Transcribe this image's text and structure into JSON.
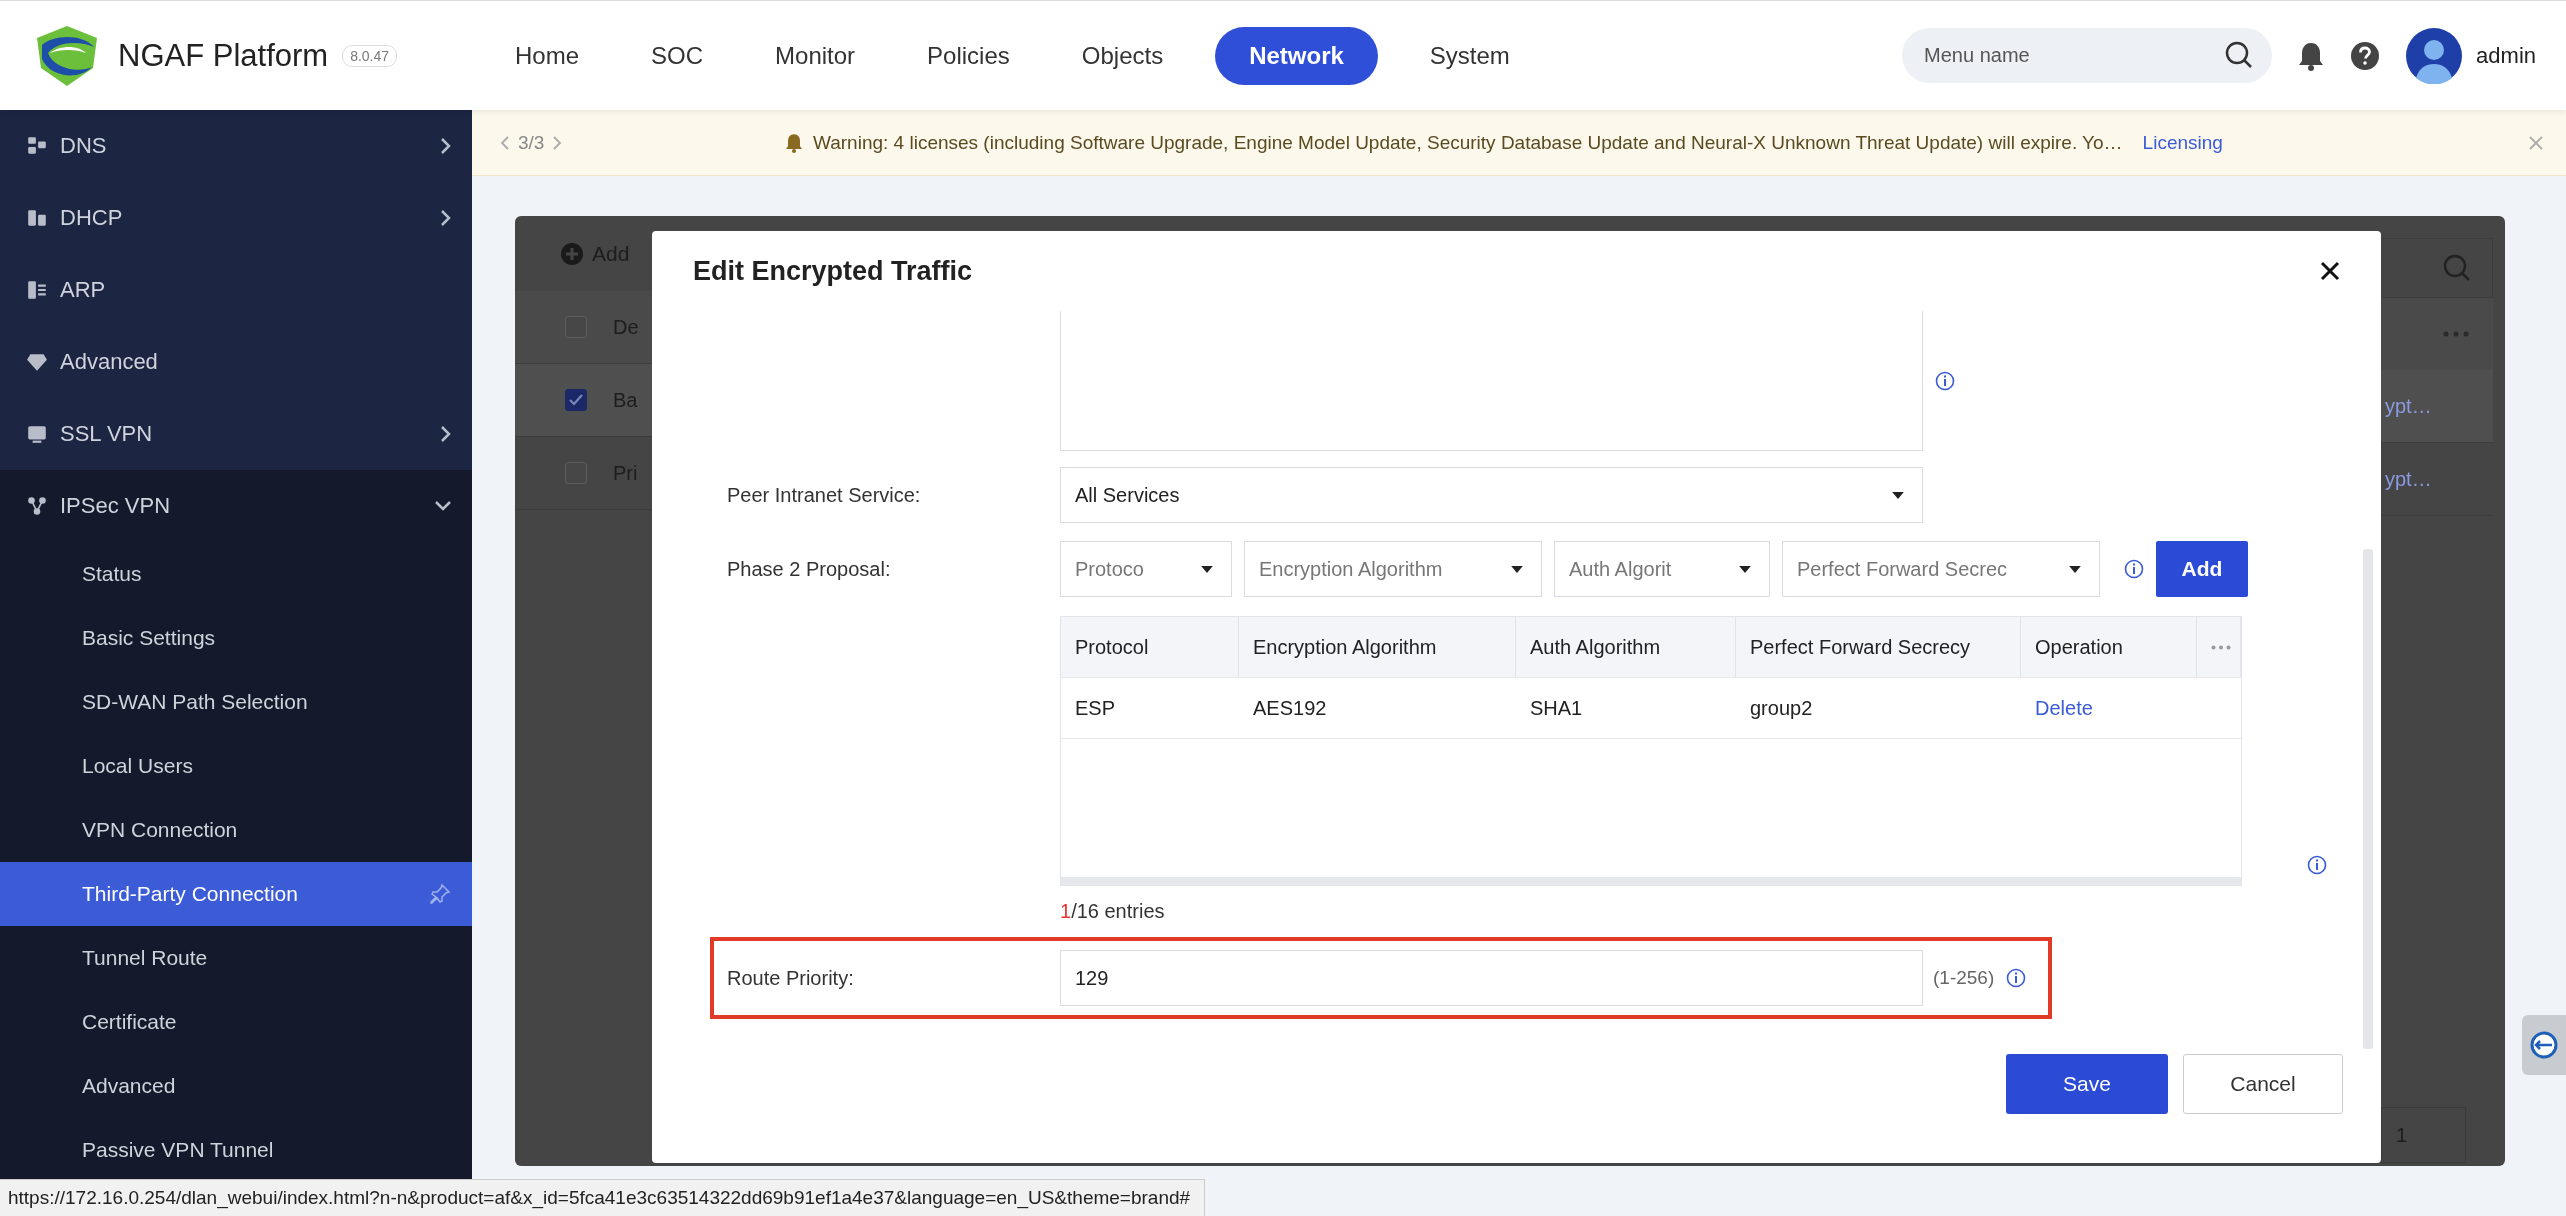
{
  "header": {
    "logo_text": "NGAF Platform",
    "version": "8.0.47",
    "nav": [
      {
        "label": "Home",
        "selected": false
      },
      {
        "label": "SOC",
        "selected": false
      },
      {
        "label": "Monitor",
        "selected": false
      },
      {
        "label": "Policies",
        "selected": false
      },
      {
        "label": "Objects",
        "selected": false
      },
      {
        "label": "Network",
        "selected": true
      },
      {
        "label": "System",
        "selected": false
      }
    ],
    "search": {
      "placeholder": "Menu name"
    },
    "user": "admin"
  },
  "sidebar": {
    "items": [
      {
        "label": "DNS",
        "kind": "group",
        "expanded": false
      },
      {
        "label": "DHCP",
        "kind": "group",
        "expanded": false
      },
      {
        "label": "ARP",
        "kind": "link"
      },
      {
        "label": "Advanced",
        "kind": "link"
      },
      {
        "label": "SSL VPN",
        "kind": "group",
        "expanded": false
      },
      {
        "label": "IPSec VPN",
        "kind": "group",
        "expanded": true,
        "children": [
          {
            "label": "Status",
            "selected": false
          },
          {
            "label": "Basic Settings",
            "selected": false
          },
          {
            "label": "SD-WAN Path Selection",
            "selected": false
          },
          {
            "label": "Local Users",
            "selected": false
          },
          {
            "label": "VPN Connection",
            "selected": false
          },
          {
            "label": "Third-Party Connection",
            "selected": true
          },
          {
            "label": "Tunnel Route",
            "selected": false
          },
          {
            "label": "Certificate",
            "selected": false
          },
          {
            "label": "Advanced",
            "selected": false
          },
          {
            "label": "Passive VPN Tunnel",
            "selected": false
          }
        ]
      }
    ]
  },
  "notice": {
    "pager": "3/3",
    "text": "Warning: 4 licenses (including Software Upgrade, Engine Model Update, Security Database Update and Neural-X Unknown Threat Update) will expire. Yo…",
    "link": "Licensing"
  },
  "background_list": {
    "add_label": "Add",
    "rows": [
      {
        "kind": "header",
        "text": "De",
        "checked": false
      },
      {
        "kind": "row",
        "text": "Ba",
        "checked": true,
        "link": "ypt…"
      },
      {
        "kind": "row",
        "text": "Pri",
        "checked": false,
        "link": "ypt…"
      }
    ],
    "page": "1"
  },
  "dialog": {
    "title": "Edit Encrypted Traffic",
    "peer_service": {
      "label": "Peer Intranet Service:",
      "value": "All Services"
    },
    "phase2": {
      "label": "Phase 2 Proposal:",
      "selects": [
        {
          "placeholder": "Protoco"
        },
        {
          "placeholder": "Encryption Algorithm"
        },
        {
          "placeholder": "Auth Algorit"
        },
        {
          "placeholder": "Perfect Forward Secrec"
        }
      ],
      "add": "Add",
      "table": {
        "columns": [
          "Protocol",
          "Encryption Algorithm",
          "Auth Algorithm",
          "Perfect Forward Secrecy",
          "Operation"
        ],
        "rows": [
          [
            "ESP",
            "AES192",
            "SHA1",
            "group2",
            "Delete"
          ]
        ]
      },
      "count_current": "1",
      "count_total": "/16 entries"
    },
    "route_priority": {
      "label": "Route Priority:",
      "value": "129",
      "range": "(1-256)",
      "highlighted": true
    },
    "buttons": {
      "save": "Save",
      "cancel": "Cancel"
    }
  },
  "status_url": "https://172.16.0.254/dlan_webui/index.html?n-n&product=af&x_id=5fca41e3c63514322dd69b91ef1a4e37&language=en_US&theme=brand#"
}
